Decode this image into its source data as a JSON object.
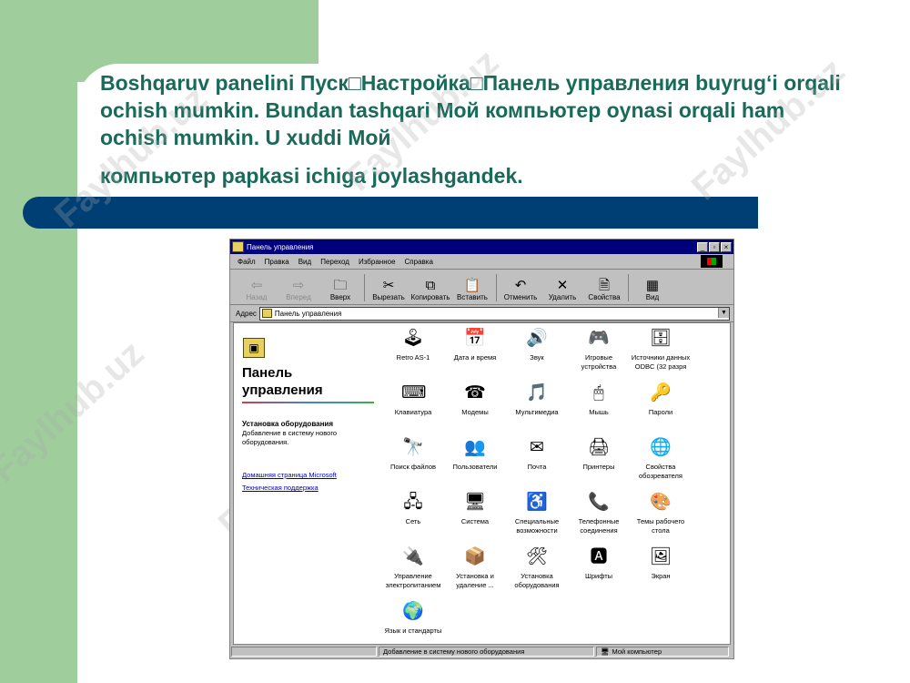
{
  "slide": {
    "text_main": "Boshqaruv panelini Пуск□Настройка□Панель управления buyrug‘i orqali ochish mumkin. Bundan tashqari Мой компьютер oynasi orqali ham ochish mumkin. U xuddi Мой",
    "text_last": "компьютер papkasi ichiga joylashgandek.",
    "watermark": "Faylhub.uz",
    "colors": {
      "green": "#9fce9c",
      "navy_bar": "#003f74",
      "heading": "#1a6a5a"
    }
  },
  "window": {
    "title": "Панель управления",
    "controls": {
      "minimize": "_",
      "maximize": "▫",
      "close": "×"
    },
    "menu": [
      "Файл",
      "Правка",
      "Вид",
      "Переход",
      "Избранное",
      "Справка"
    ],
    "toolbar": [
      {
        "label": "Назад",
        "icon": "arrow-left-icon",
        "glyph": "⇦",
        "disabled": true
      },
      {
        "label": "Вперед",
        "icon": "arrow-right-icon",
        "glyph": "⇨",
        "disabled": true
      },
      {
        "label": "Вверх",
        "icon": "folder-up-icon",
        "glyph": "🗀",
        "disabled": false
      },
      {
        "label": "Вырезать",
        "icon": "scissors-icon",
        "glyph": "✂",
        "disabled": false
      },
      {
        "label": "Копировать",
        "icon": "copy-icon",
        "glyph": "⧉",
        "disabled": false
      },
      {
        "label": "Вставить",
        "icon": "paste-icon",
        "glyph": "📋",
        "disabled": false
      },
      {
        "label": "Отменить",
        "icon": "undo-icon",
        "glyph": "↶",
        "disabled": false
      },
      {
        "label": "Удалить",
        "icon": "delete-icon",
        "glyph": "✕",
        "disabled": false
      },
      {
        "label": "Свойства",
        "icon": "properties-icon",
        "glyph": "🗎",
        "disabled": false
      },
      {
        "label": "Вид",
        "icon": "view-icon",
        "glyph": "▦",
        "disabled": false
      }
    ],
    "address_label": "Адрес",
    "address_value": "Панель управления",
    "left_pane": {
      "title": "Панель управления",
      "section_heading": "Установка оборудования",
      "section_desc": "Добавление в систему нового оборудования.",
      "link_homepage": "Домашняя страница Microsoft",
      "link_support": "Техническая поддержка"
    },
    "items": [
      {
        "label": "Retro AS-1",
        "icon": "joystick-icon",
        "glyph": "🕹"
      },
      {
        "label": "Дата и время",
        "icon": "calendar-clock-icon",
        "glyph": "📅"
      },
      {
        "label": "Звук",
        "icon": "speaker-icon",
        "glyph": "🔊"
      },
      {
        "label": "Игровые устройства",
        "icon": "gamepad-icon",
        "glyph": "🎮"
      },
      {
        "label": "Источники данных ODBC (32 разря",
        "icon": "database-icon",
        "glyph": "🗄"
      },
      {
        "label": "Клавиатура",
        "icon": "keyboard-icon",
        "glyph": "⌨"
      },
      {
        "label": "Модемы",
        "icon": "modem-icon",
        "glyph": "☎"
      },
      {
        "label": "Мультимедиа",
        "icon": "multimedia-icon",
        "glyph": "🎵"
      },
      {
        "label": "Мышь",
        "icon": "mouse-icon",
        "glyph": "🖱"
      },
      {
        "label": "Пароли",
        "icon": "key-icon",
        "glyph": "🔑"
      },
      {
        "label": "Поиск файлов",
        "icon": "binoculars-icon",
        "glyph": "🔭"
      },
      {
        "label": "Пользователи",
        "icon": "users-icon",
        "glyph": "👥"
      },
      {
        "label": "Почта",
        "icon": "mail-icon",
        "glyph": "✉"
      },
      {
        "label": "Принтеры",
        "icon": "printer-icon",
        "glyph": "🖨"
      },
      {
        "label": "Свойства обозревателя",
        "icon": "globe-icon",
        "glyph": "🌐"
      },
      {
        "label": "Сеть",
        "icon": "network-icon",
        "glyph": "🖧"
      },
      {
        "label": "Система",
        "icon": "computer-icon",
        "glyph": "🖥"
      },
      {
        "label": "Специальные возможности",
        "icon": "accessibility-icon",
        "glyph": "♿"
      },
      {
        "label": "Телефонные соединения",
        "icon": "telephony-icon",
        "glyph": "📞"
      },
      {
        "label": "Темы рабочего стола",
        "icon": "themes-icon",
        "glyph": "🎨"
      },
      {
        "label": "Управление электропитанием",
        "icon": "power-icon",
        "glyph": "🔌"
      },
      {
        "label": "Установка и удаление ...",
        "icon": "install-icon",
        "glyph": "📦"
      },
      {
        "label": "Установка оборудования",
        "icon": "hardware-icon",
        "glyph": "🛠"
      },
      {
        "label": "Шрифты",
        "icon": "fonts-icon",
        "glyph": "🅰"
      },
      {
        "label": "Экран",
        "icon": "display-icon",
        "glyph": "🖼"
      },
      {
        "label": "Язык и стандарты",
        "icon": "globe-icon",
        "glyph": "🌍"
      }
    ],
    "status_desc": "Добавление в систему нового оборудования",
    "status_location": "Мой компьютер",
    "status_location_glyph": "🖥"
  }
}
